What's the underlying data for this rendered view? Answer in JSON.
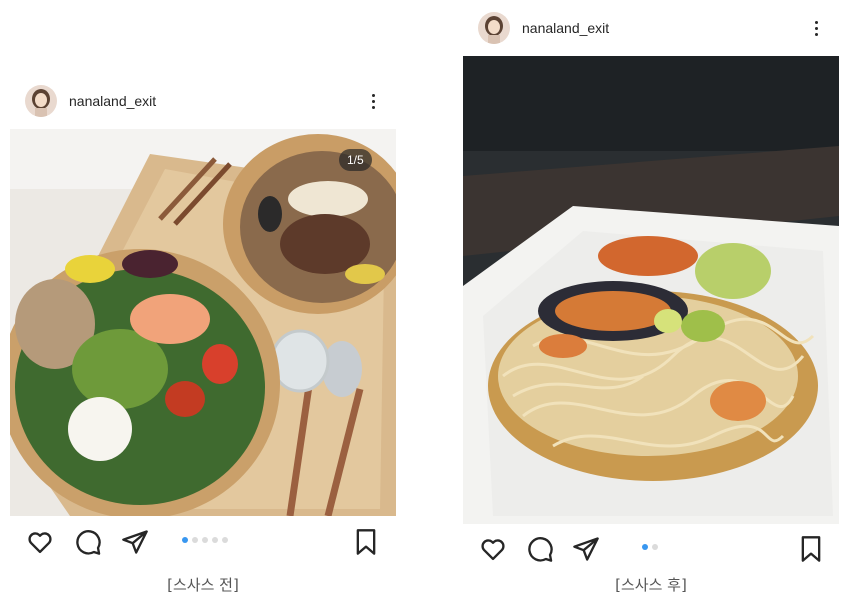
{
  "posts": [
    {
      "username": "nanaland_exit",
      "counter": "1/5",
      "slide_count": 5,
      "active_slide": 1,
      "caption": "[스사스 전]",
      "icons": [
        "avatar",
        "more-icon",
        "heart-icon",
        "comment-icon",
        "share-icon",
        "bookmark-icon"
      ]
    },
    {
      "username": "nanaland_exit",
      "slide_count": 2,
      "active_slide": 1,
      "caption": "[스사스 후]",
      "icons": [
        "avatar",
        "more-icon",
        "heart-icon",
        "comment-icon",
        "share-icon",
        "bookmark-icon"
      ]
    }
  ],
  "colors": {
    "active_dot": "#3897f0",
    "inactive_dot": "#dbdbdb",
    "text": "#262626"
  }
}
